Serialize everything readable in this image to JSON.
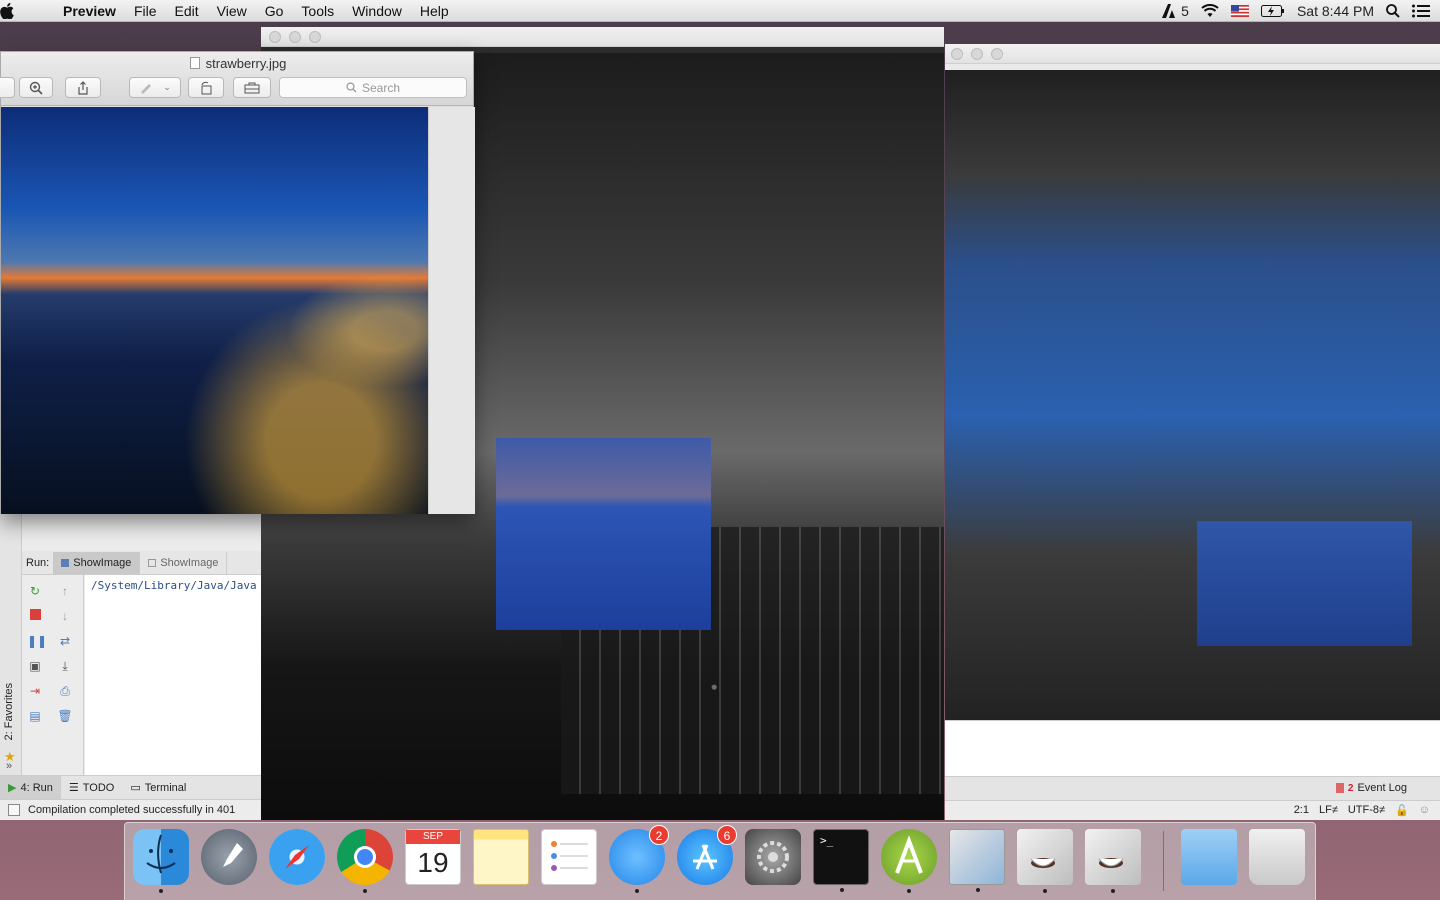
{
  "menubar": {
    "app": "Preview",
    "items": [
      "File",
      "Edit",
      "View",
      "Go",
      "Tools",
      "Window",
      "Help"
    ],
    "status": {
      "adobe_count": "5",
      "clock": "Sat 8:44 PM"
    }
  },
  "preview": {
    "filename": "strawberry.jpg",
    "search_placeholder": "Search"
  },
  "ide": {
    "run_label": "Run:",
    "run_tabs": [
      "ShowImage",
      "ShowImage"
    ],
    "console_line": "/System/Library/Java/Java",
    "favorites_label": "2: Favorites",
    "bottom_tabs": [
      "4: Run",
      "TODO",
      "Terminal"
    ],
    "status_text": "Compilation completed successfully in 401",
    "event_log_count": "2",
    "event_log_label": "Event Log",
    "caret_pos": "2:1",
    "line_sep": "LF≠",
    "encoding": "UTF-8≠"
  },
  "dock": {
    "calendar_month": "SEP",
    "calendar_day": "19",
    "messages_badge": "2",
    "appstore_badge": "6",
    "terminal_prompt": ">_"
  },
  "colors": {
    "accent": "#2a61b0",
    "badge": "#e93b30"
  }
}
